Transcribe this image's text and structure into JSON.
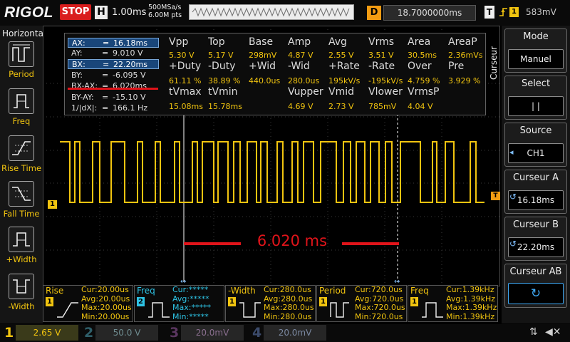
{
  "topbar": {
    "brand": "RIGOL",
    "run_state": "STOP",
    "timebase_key": "H",
    "timebase_value": "1.00ms",
    "sample_rate": "500MSa/s",
    "memory_depth": "6.00M pts",
    "delay_key": "D",
    "delay_value": "18.7000000ms",
    "trigger_key": "T",
    "trigger_channel": "1",
    "trigger_level": "583mV"
  },
  "left_panel": {
    "title": "Horizontal",
    "items": [
      {
        "label": "Period"
      },
      {
        "label": "Freq"
      },
      {
        "label": "Rise Time"
      },
      {
        "label": "Fall Time"
      },
      {
        "label": "+Width"
      },
      {
        "label": "-Width"
      }
    ]
  },
  "cursor_readout": {
    "rows": [
      {
        "name": "AX:",
        "eq": "=",
        "value": "16.18ms"
      },
      {
        "name": "AY:",
        "eq": "=",
        "value": "9.010 V"
      },
      {
        "name": "BX:",
        "eq": "=",
        "value": "22.20ms"
      },
      {
        "name": "BY:",
        "eq": "=",
        "value": "-6.095 V"
      },
      {
        "name": "BX-AX:",
        "eq": "=",
        "value": "6.020ms"
      },
      {
        "name": "BY-AY:",
        "eq": "=",
        "value": "-15.10 V"
      },
      {
        "name": "1/|dX|:",
        "eq": "=",
        "value": "166.1 Hz"
      }
    ]
  },
  "measurements": {
    "row1_headers": [
      "Vpp",
      "Top",
      "Base",
      "Amp",
      "Avg",
      "Vrms",
      "Area",
      "AreaP"
    ],
    "row1_values": [
      "5.30 V",
      "5.17 V",
      "298mV",
      "4.87 V",
      "2.55 V",
      "3.51 V",
      "30.5ms",
      "2.36mVs"
    ],
    "row2_headers": [
      "+Duty",
      "-Duty",
      "+Wid",
      "-Wid",
      "+Rate",
      "-Rate",
      "Over",
      "Pre"
    ],
    "row2_values": [
      "61.11 %",
      "38.89 %",
      "440.0us",
      "280.0us",
      "195kV/s",
      "-195kV/s",
      "4.759 %",
      "3.929 %"
    ],
    "row3_headers": [
      "tVmax",
      "tVmin",
      "",
      "Vupper",
      "Vmid",
      "Vlower",
      "VrmsP",
      ""
    ],
    "row3_values": [
      "15.08ms",
      "15.78ms",
      "",
      "4.69 V",
      "2.73 V",
      "785mV",
      "4.04 V",
      ""
    ]
  },
  "annotation": {
    "delta_label": "6.020 ms"
  },
  "markers": {
    "channel1_ground": "1",
    "trigger_marker": "T"
  },
  "right_panel": {
    "side_label": "Curseur",
    "mode": {
      "title": "Mode",
      "value": "Manuel"
    },
    "select": {
      "title": "Select",
      "value": "|   |"
    },
    "source": {
      "title": "Source",
      "value": "CH1"
    },
    "cursor_a": {
      "title": "Curseur A",
      "value": "16.18ms"
    },
    "cursor_b": {
      "title": "Curseur B",
      "value": "22.20ms"
    },
    "cursor_ab": {
      "title": "Curseur AB"
    }
  },
  "bottom_measurements": [
    {
      "title": "Rise",
      "channel": "1",
      "cur": "Cur:20.00us",
      "avg": "Avg:20.00us",
      "max": "Max:20.00us",
      "min": "Min:20.00us",
      "color": "#f1c40f"
    },
    {
      "title": "Freq",
      "channel": "2",
      "cur": "Cur:*****",
      "avg": "Avg:*****",
      "max": "Max:*****",
      "min": "Min:*****",
      "color": "#2ec4e6"
    },
    {
      "title": "-Width",
      "channel": "1",
      "cur": "Cur:280.0us",
      "avg": "Avg:280.0us",
      "max": "Max:280.0us",
      "min": "Min:280.0us",
      "color": "#f1c40f"
    },
    {
      "title": "Period",
      "channel": "1",
      "cur": "Cur:720.0us",
      "avg": "Avg:720.0us",
      "max": "Max:720.0us",
      "min": "Min:720.0us",
      "color": "#f1c40f"
    },
    {
      "title": "Freq",
      "channel": "1",
      "cur": "Cur:1.39kHz",
      "avg": "Avg:1.39kHz",
      "max": "Max:1.39kHz",
      "min": "Min:1.39kHz",
      "color": "#f1c40f"
    }
  ],
  "channels": [
    {
      "num": "1",
      "scale": "2.65 V",
      "color": "#f1c40f"
    },
    {
      "num": "2",
      "scale": "50.0 V",
      "color": "#2ec4e6"
    },
    {
      "num": "3",
      "scale": "20.0mV",
      "color": "#e040fb"
    },
    {
      "num": "4",
      "scale": "20.0mV",
      "color": "#3a7bd5"
    }
  ],
  "colors": {
    "ch1": "#f1c40f",
    "cursor": "#ffffff",
    "highlight": "#e0141a"
  }
}
